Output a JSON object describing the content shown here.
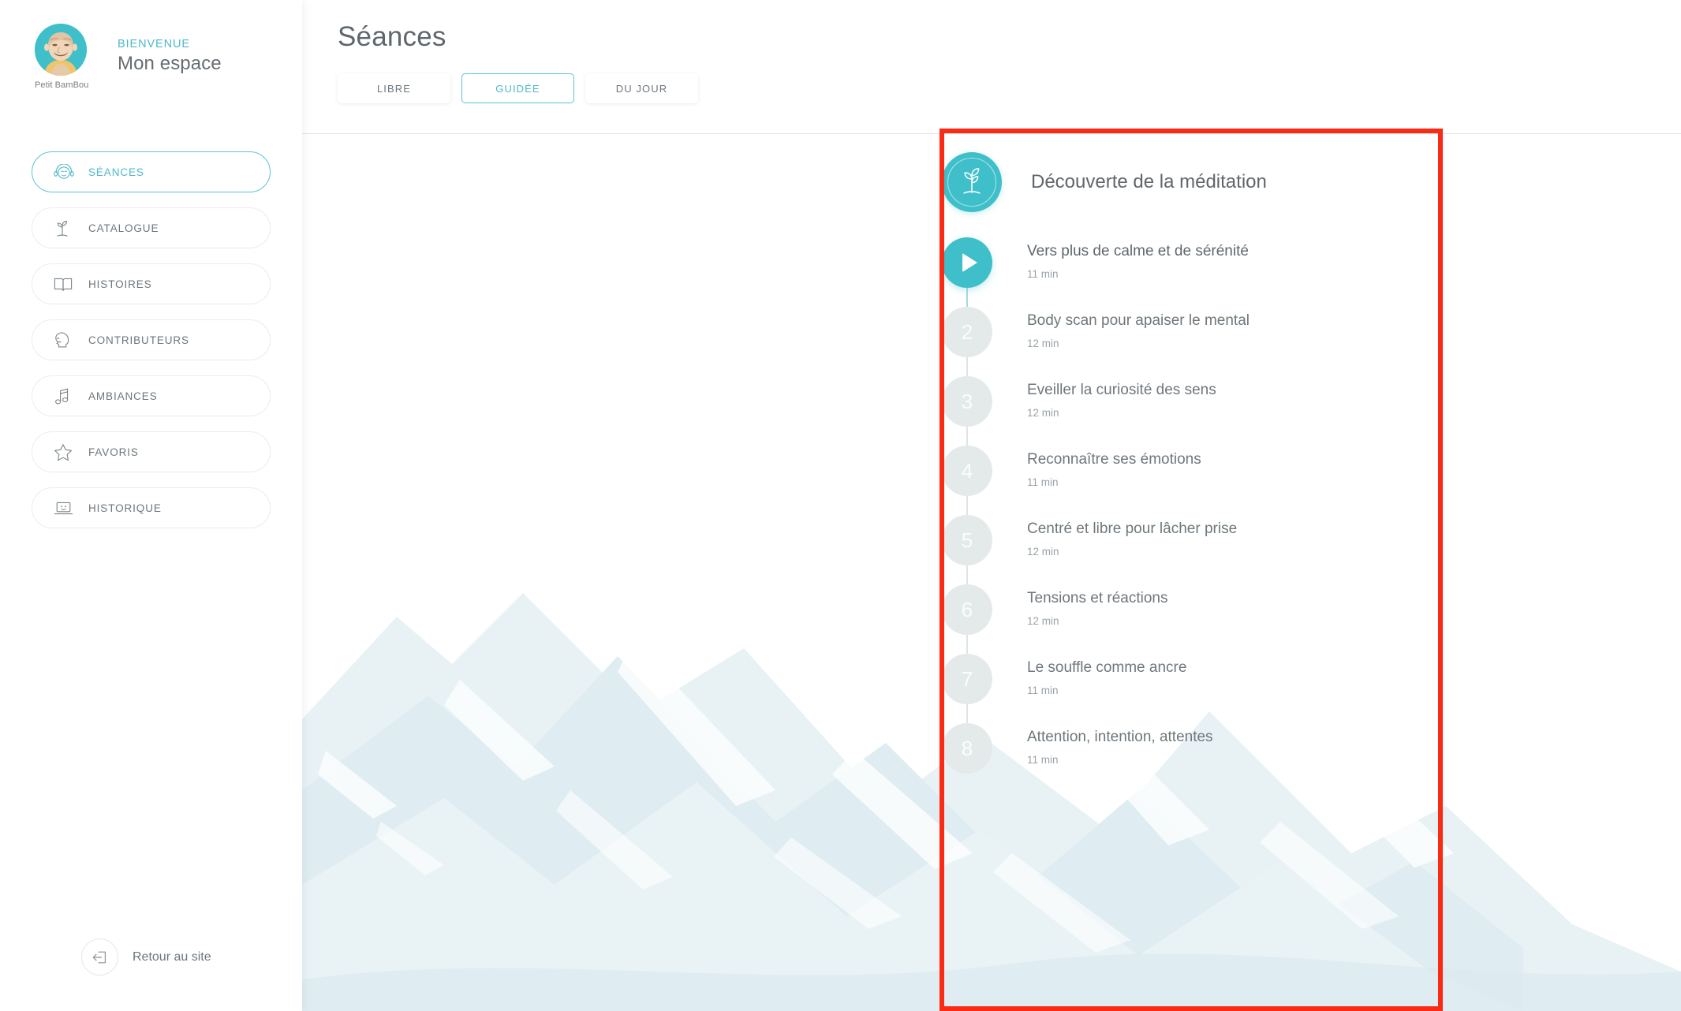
{
  "sidebar": {
    "profile": {
      "avatar_icon": "monk-avatar",
      "avatar_name": "Petit BamBou",
      "welcome": "BIENVENUE",
      "space_name": "Mon espace"
    },
    "items": [
      {
        "label": "SÉANCES",
        "icon": "headphones-face-icon",
        "active": true
      },
      {
        "label": "CATALOGUE",
        "icon": "sprout-icon",
        "active": false
      },
      {
        "label": "HISTOIRES",
        "icon": "open-book-icon",
        "active": false
      },
      {
        "label": "CONTRIBUTEURS",
        "icon": "speaking-head-icon",
        "active": false
      },
      {
        "label": "AMBIANCES",
        "icon": "music-note-icon",
        "active": false
      },
      {
        "label": "FAVORIS",
        "icon": "star-icon",
        "active": false
      },
      {
        "label": "HISTORIQUE",
        "icon": "laptop-icon",
        "active": false
      }
    ],
    "back_to_site": {
      "label": "Retour au site",
      "icon": "exit-arrow-icon"
    }
  },
  "main": {
    "page_title": "Séances",
    "tabs": [
      {
        "label": "LIBRE",
        "active": false
      },
      {
        "label": "GUIDÉE",
        "active": true
      },
      {
        "label": "DU JOUR",
        "active": false
      }
    ]
  },
  "program": {
    "badge_icon": "sprout-icon",
    "title": "Découverte de la méditation",
    "steps": [
      {
        "number": "1",
        "name": "Vers plus de calme et de sérénité",
        "duration": "11 min",
        "state": "playing"
      },
      {
        "number": "2",
        "name": "Body scan pour apaiser le mental",
        "duration": "12 min",
        "state": "locked"
      },
      {
        "number": "3",
        "name": "Eveiller la curiosité des sens",
        "duration": "12 min",
        "state": "locked"
      },
      {
        "number": "4",
        "name": "Reconnaître ses émotions",
        "duration": "11 min",
        "state": "locked"
      },
      {
        "number": "5",
        "name": "Centré et libre pour lâcher prise",
        "duration": "12 min",
        "state": "locked"
      },
      {
        "number": "6",
        "name": "Tensions et réactions",
        "duration": "12 min",
        "state": "locked"
      },
      {
        "number": "7",
        "name": "Le souffle comme ancre",
        "duration": "11 min",
        "state": "locked"
      },
      {
        "number": "8",
        "name": "Attention, intention, attentes",
        "duration": "11 min",
        "state": "locked"
      }
    ]
  },
  "annotation": {
    "shape": "rectangle-highlight",
    "color": "#fa2a14"
  },
  "colors": {
    "accent_teal": "#3ebfc9",
    "accent_teal_text": "#4fb8cc",
    "text_primary": "#5f676c",
    "text_secondary": "#6d767c",
    "text_muted": "#9aa2a7",
    "node_inactive": "#e4eaea",
    "border_light": "#e9ecee",
    "annotation_red": "#fa2a14",
    "background": "#ffffff"
  }
}
